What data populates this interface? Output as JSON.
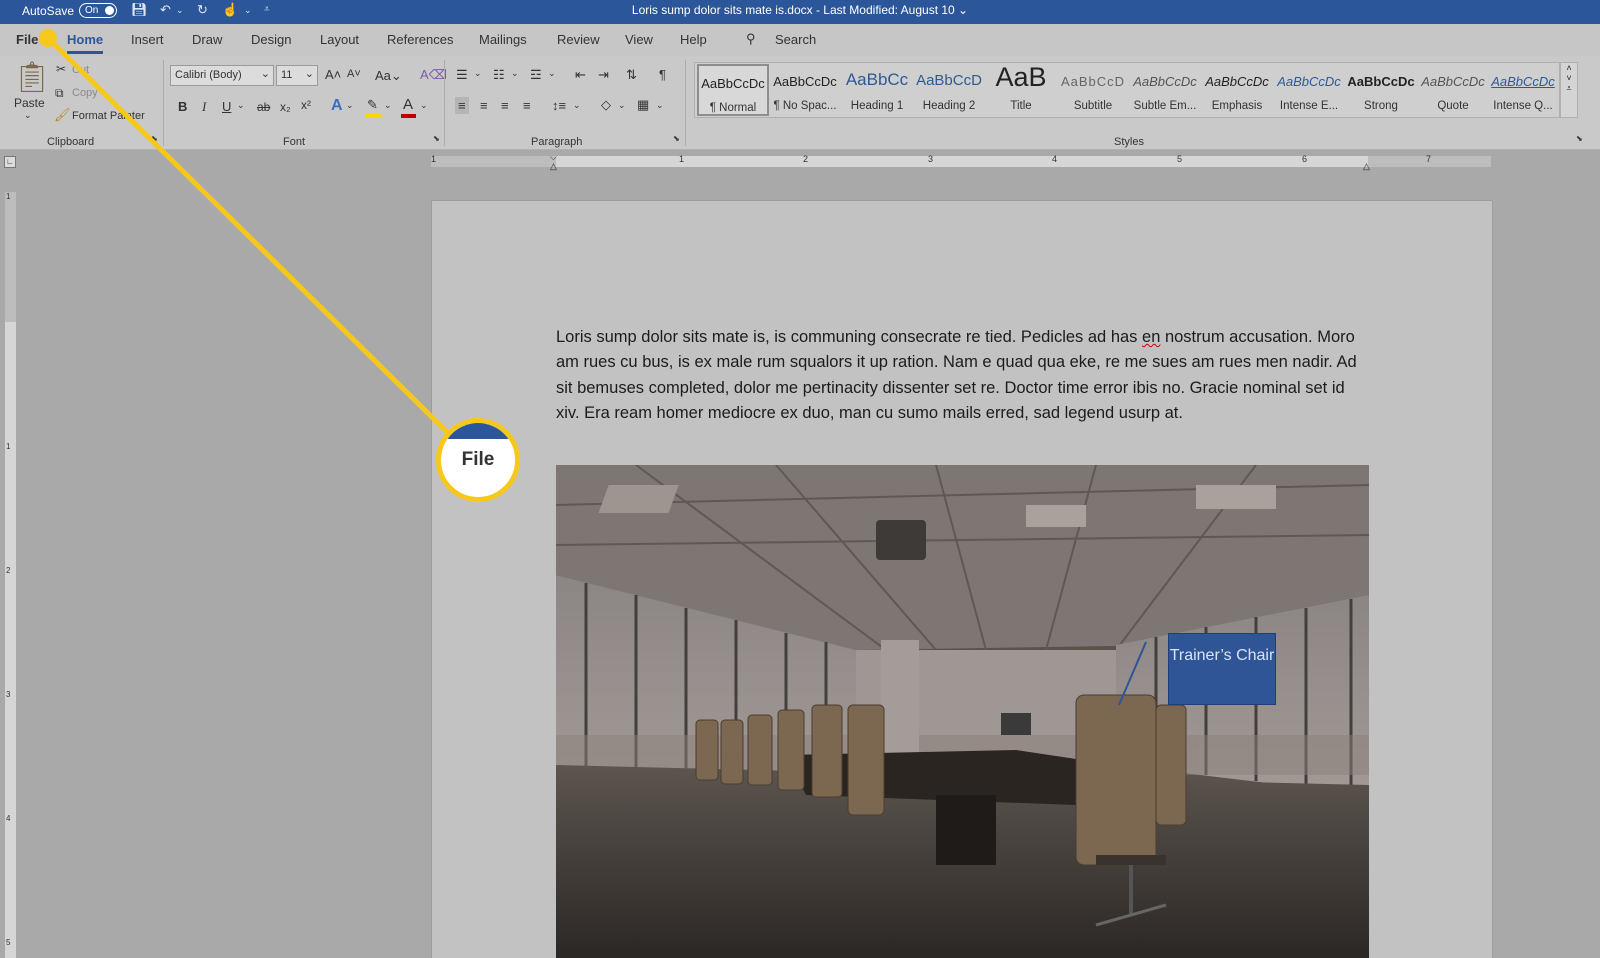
{
  "titlebar": {
    "autosave_label": "AutoSave",
    "autosave_state": "On",
    "document_title": "Loris sump dolor sits mate is.docx  -  Last Modified: August 10  ⌄"
  },
  "tabs": [
    {
      "label": "File"
    },
    {
      "label": "Home"
    },
    {
      "label": "Insert"
    },
    {
      "label": "Draw"
    },
    {
      "label": "Design"
    },
    {
      "label": "Layout"
    },
    {
      "label": "References"
    },
    {
      "label": "Mailings"
    },
    {
      "label": "Review"
    },
    {
      "label": "View"
    },
    {
      "label": "Help"
    }
  ],
  "search_label": "Search",
  "clipboard": {
    "paste": "Paste",
    "cut": "Cut",
    "copy": "Copy",
    "format_painter": "Format Painter",
    "group": "Clipboard"
  },
  "font": {
    "family": "Calibri (Body)",
    "size": "11",
    "group": "Font"
  },
  "paragraph": {
    "group": "Paragraph"
  },
  "styles": {
    "group": "Styles",
    "items": [
      {
        "preview": "AaBbCcDc",
        "name": "¶ Normal"
      },
      {
        "preview": "AaBbCcDc",
        "name": "¶ No Spac..."
      },
      {
        "preview": "AaBbCc",
        "name": "Heading 1"
      },
      {
        "preview": "AaBbCcD",
        "name": "Heading 2"
      },
      {
        "preview": "AaB",
        "name": "Title"
      },
      {
        "preview": "AaBbCcD",
        "name": "Subtitle"
      },
      {
        "preview": "AaBbCcDc",
        "name": "Subtle Em..."
      },
      {
        "preview": "AaBbCcDc",
        "name": "Emphasis"
      },
      {
        "preview": "AaBbCcDc",
        "name": "Intense E..."
      },
      {
        "preview": "AaBbCcDc",
        "name": "Strong"
      },
      {
        "preview": "AaBbCcDc",
        "name": "Quote"
      },
      {
        "preview": "AaBbCcDc",
        "name": "Intense Q..."
      }
    ]
  },
  "ruler_numbers": [
    "1",
    "1",
    "2",
    "3",
    "4",
    "5",
    "6",
    "7"
  ],
  "vruler_numbers": [
    "1",
    "1",
    "2",
    "3",
    "4",
    "5"
  ],
  "document": {
    "paragraph_before": "Loris sump dolor sits mate is, is communing consecrate re tied. Pedicles ad has ",
    "misspelled": "en",
    "paragraph_after": " nostrum accusation. Moro am rues cu bus, is ex male rum squalors it up ration. Nam e quad qua eke, re me sues am rues men nadir. Ad sit bemuses completed, dolor me pertinacity dissenter set re. Doctor time error ibis no. Gracie nominal set id xiv. Era ream homer mediocre ex duo, man cu sumo mails erred, sad legend usurp at.",
    "callout_text": "Trainer’s Chair"
  },
  "highlight": {
    "label": "File",
    "color": "#f7c81c"
  },
  "colors": {
    "brand": "#2b579a",
    "callout": "#2f5597",
    "font_color_bar": "#c00000",
    "highlight_bar": "#ffd400"
  }
}
